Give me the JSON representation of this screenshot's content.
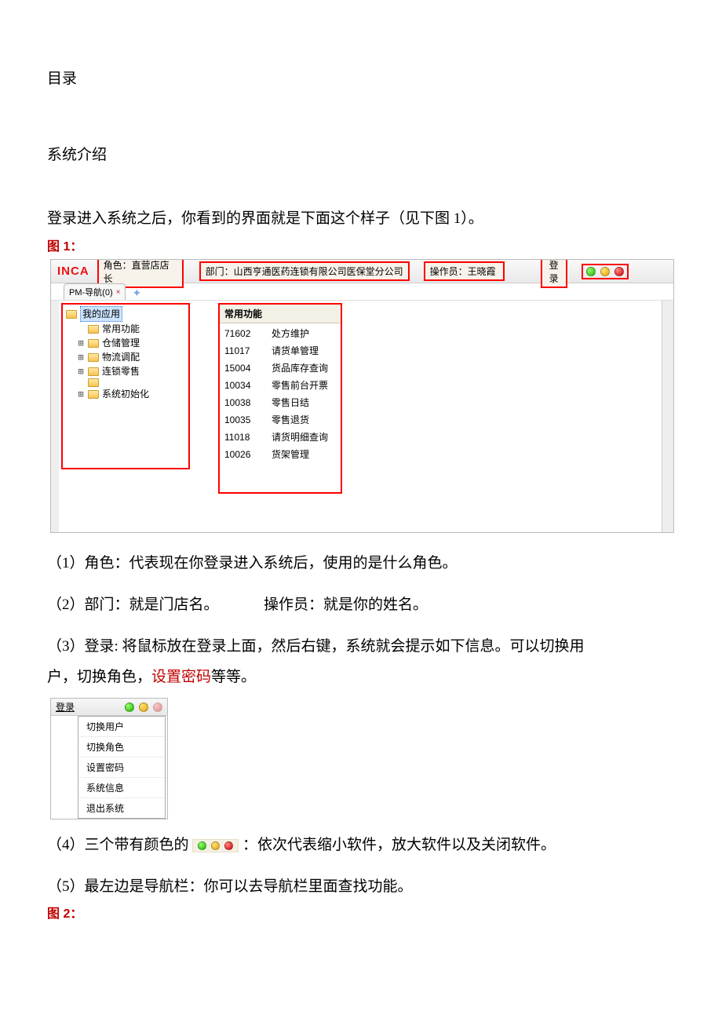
{
  "doc": {
    "toc_heading": "目录",
    "section_heading": "系统介绍",
    "intro_line": "登录进入系统之后，你看到的界面就是下面这个样子（见下图 1）。",
    "fig1_label": "图 1：",
    "fig2_label": "图 2："
  },
  "screenshot1": {
    "logo": "INCA",
    "role_label": "角色：直营店店长",
    "dept_label": "部门：山西亨通医药连锁有限公司医保堂分公司",
    "operator_label": "操作员：王晓霞",
    "login_label": "登录",
    "tab_label": "PM-导航(0)",
    "nav_root": "我的应用",
    "nav_items": [
      {
        "exp": "",
        "indent": 1,
        "label": "常用功能"
      },
      {
        "exp": "+",
        "indent": 1,
        "label": "仓储管理"
      },
      {
        "exp": "+",
        "indent": 1,
        "label": "物流调配"
      },
      {
        "exp": "+",
        "indent": 1,
        "label": "连锁零售"
      },
      {
        "exp": "",
        "indent": 1,
        "label": ""
      },
      {
        "exp": "+",
        "indent": 1,
        "label": "系统初始化"
      }
    ],
    "func_header": "常用功能",
    "funcs": [
      {
        "code": "71602",
        "name": "处方维护"
      },
      {
        "code": "11017",
        "name": "请货单管理"
      },
      {
        "code": "15004",
        "name": "货品库存查询"
      },
      {
        "code": "10034",
        "name": "零售前台开票"
      },
      {
        "code": "10038",
        "name": "零售日结"
      },
      {
        "code": "10035",
        "name": "零售退货"
      },
      {
        "code": "11018",
        "name": "请货明细查询"
      },
      {
        "code": "10026",
        "name": "货架管理"
      }
    ]
  },
  "explain": {
    "p1": "（1）角色：代表现在你登录进入系统后，使用的是什么角色。",
    "p2a": "（2）部门：就是门店名。",
    "p2b": "操作员：就是你的姓名。",
    "p3_line1": "（3）登录: 将鼠标放在登录上面，然后右键，系统就会提示如下信息。可以切换用",
    "p3_line2_a": "户，切换角色，",
    "p3_line2_hl": "设置密码",
    "p3_line2_b": "等等。",
    "p4_a": "（4）三个带有颜色的",
    "p4_b": "：依次代表缩小软件，放大软件以及关闭软件。",
    "p5": "（5）最左边是导航栏：你可以去导航栏里面查找功能。"
  },
  "ctx": {
    "login": "登录",
    "items": [
      "切换用户",
      "切换角色",
      "设置密码",
      "系统信息",
      "退出系统"
    ]
  }
}
